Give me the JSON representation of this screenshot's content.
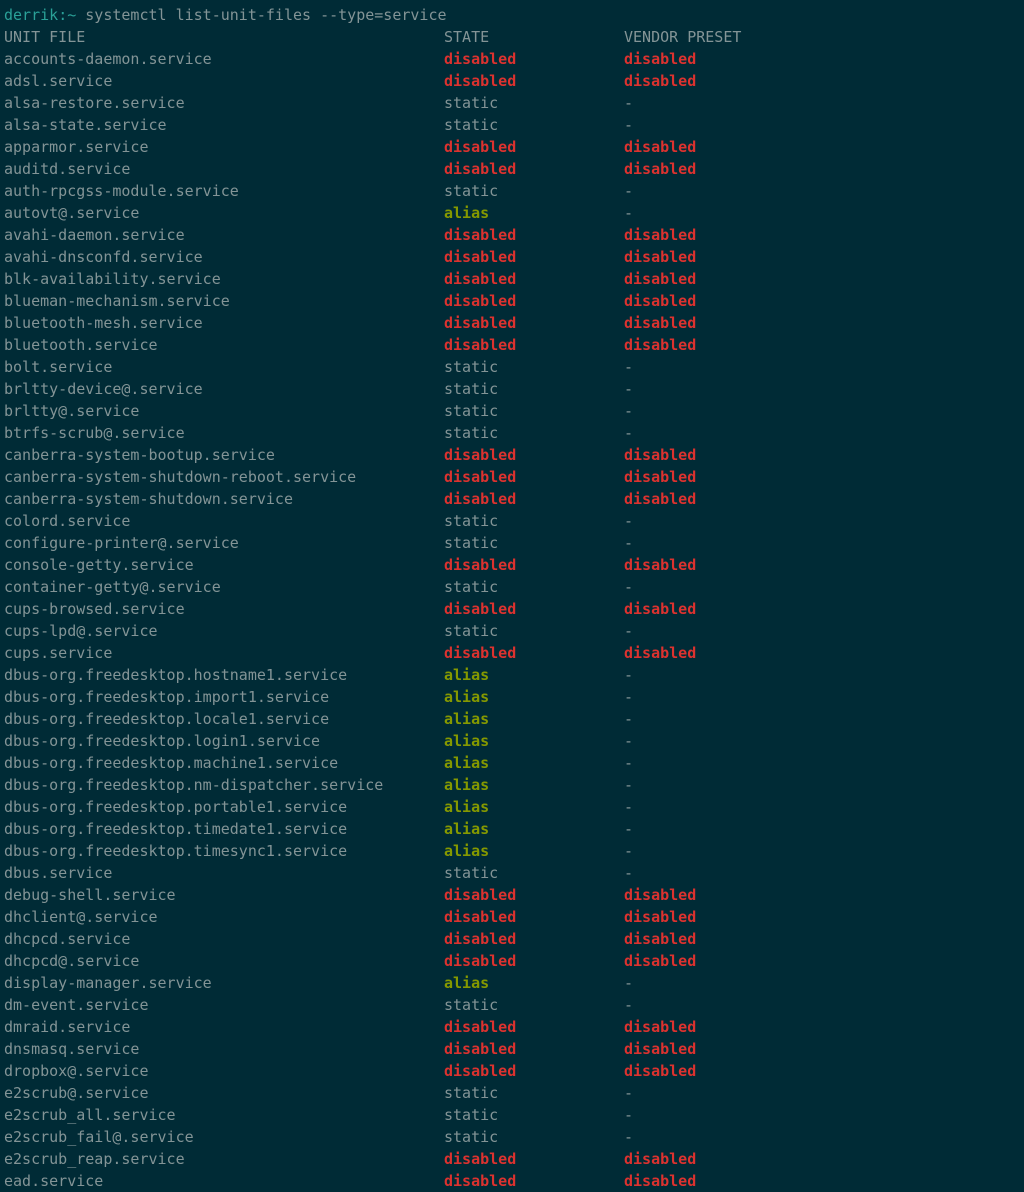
{
  "prompt": {
    "user": "derrik",
    "separator": ":",
    "path": "~",
    "command": "systemctl list-unit-files --type=service"
  },
  "header": {
    "unit": "UNIT FILE",
    "state": "STATE",
    "preset": "VENDOR PRESET"
  },
  "rows": [
    {
      "unit": "accounts-daemon.service",
      "state": "disabled",
      "preset": "disabled"
    },
    {
      "unit": "adsl.service",
      "state": "disabled",
      "preset": "disabled"
    },
    {
      "unit": "alsa-restore.service",
      "state": "static",
      "preset": "-"
    },
    {
      "unit": "alsa-state.service",
      "state": "static",
      "preset": "-"
    },
    {
      "unit": "apparmor.service",
      "state": "disabled",
      "preset": "disabled"
    },
    {
      "unit": "auditd.service",
      "state": "disabled",
      "preset": "disabled"
    },
    {
      "unit": "auth-rpcgss-module.service",
      "state": "static",
      "preset": "-"
    },
    {
      "unit": "autovt@.service",
      "state": "alias",
      "preset": "-"
    },
    {
      "unit": "avahi-daemon.service",
      "state": "disabled",
      "preset": "disabled"
    },
    {
      "unit": "avahi-dnsconfd.service",
      "state": "disabled",
      "preset": "disabled"
    },
    {
      "unit": "blk-availability.service",
      "state": "disabled",
      "preset": "disabled"
    },
    {
      "unit": "blueman-mechanism.service",
      "state": "disabled",
      "preset": "disabled"
    },
    {
      "unit": "bluetooth-mesh.service",
      "state": "disabled",
      "preset": "disabled"
    },
    {
      "unit": "bluetooth.service",
      "state": "disabled",
      "preset": "disabled"
    },
    {
      "unit": "bolt.service",
      "state": "static",
      "preset": "-"
    },
    {
      "unit": "brltty-device@.service",
      "state": "static",
      "preset": "-"
    },
    {
      "unit": "brltty@.service",
      "state": "static",
      "preset": "-"
    },
    {
      "unit": "btrfs-scrub@.service",
      "state": "static",
      "preset": "-"
    },
    {
      "unit": "canberra-system-bootup.service",
      "state": "disabled",
      "preset": "disabled"
    },
    {
      "unit": "canberra-system-shutdown-reboot.service",
      "state": "disabled",
      "preset": "disabled"
    },
    {
      "unit": "canberra-system-shutdown.service",
      "state": "disabled",
      "preset": "disabled"
    },
    {
      "unit": "colord.service",
      "state": "static",
      "preset": "-"
    },
    {
      "unit": "configure-printer@.service",
      "state": "static",
      "preset": "-"
    },
    {
      "unit": "console-getty.service",
      "state": "disabled",
      "preset": "disabled"
    },
    {
      "unit": "container-getty@.service",
      "state": "static",
      "preset": "-"
    },
    {
      "unit": "cups-browsed.service",
      "state": "disabled",
      "preset": "disabled"
    },
    {
      "unit": "cups-lpd@.service",
      "state": "static",
      "preset": "-"
    },
    {
      "unit": "cups.service",
      "state": "disabled",
      "preset": "disabled"
    },
    {
      "unit": "dbus-org.freedesktop.hostname1.service",
      "state": "alias",
      "preset": "-"
    },
    {
      "unit": "dbus-org.freedesktop.import1.service",
      "state": "alias",
      "preset": "-"
    },
    {
      "unit": "dbus-org.freedesktop.locale1.service",
      "state": "alias",
      "preset": "-"
    },
    {
      "unit": "dbus-org.freedesktop.login1.service",
      "state": "alias",
      "preset": "-"
    },
    {
      "unit": "dbus-org.freedesktop.machine1.service",
      "state": "alias",
      "preset": "-"
    },
    {
      "unit": "dbus-org.freedesktop.nm-dispatcher.service",
      "state": "alias",
      "preset": "-"
    },
    {
      "unit": "dbus-org.freedesktop.portable1.service",
      "state": "alias",
      "preset": "-"
    },
    {
      "unit": "dbus-org.freedesktop.timedate1.service",
      "state": "alias",
      "preset": "-"
    },
    {
      "unit": "dbus-org.freedesktop.timesync1.service",
      "state": "alias",
      "preset": "-"
    },
    {
      "unit": "dbus.service",
      "state": "static",
      "preset": "-"
    },
    {
      "unit": "debug-shell.service",
      "state": "disabled",
      "preset": "disabled"
    },
    {
      "unit": "dhclient@.service",
      "state": "disabled",
      "preset": "disabled"
    },
    {
      "unit": "dhcpcd.service",
      "state": "disabled",
      "preset": "disabled"
    },
    {
      "unit": "dhcpcd@.service",
      "state": "disabled",
      "preset": "disabled"
    },
    {
      "unit": "display-manager.service",
      "state": "alias",
      "preset": "-"
    },
    {
      "unit": "dm-event.service",
      "state": "static",
      "preset": "-"
    },
    {
      "unit": "dmraid.service",
      "state": "disabled",
      "preset": "disabled"
    },
    {
      "unit": "dnsmasq.service",
      "state": "disabled",
      "preset": "disabled"
    },
    {
      "unit": "dropbox@.service",
      "state": "disabled",
      "preset": "disabled"
    },
    {
      "unit": "e2scrub@.service",
      "state": "static",
      "preset": "-"
    },
    {
      "unit": "e2scrub_all.service",
      "state": "static",
      "preset": "-"
    },
    {
      "unit": "e2scrub_fail@.service",
      "state": "static",
      "preset": "-"
    },
    {
      "unit": "e2scrub_reap.service",
      "state": "disabled",
      "preset": "disabled"
    },
    {
      "unit": "ead.service",
      "state": "disabled",
      "preset": "disabled"
    }
  ]
}
